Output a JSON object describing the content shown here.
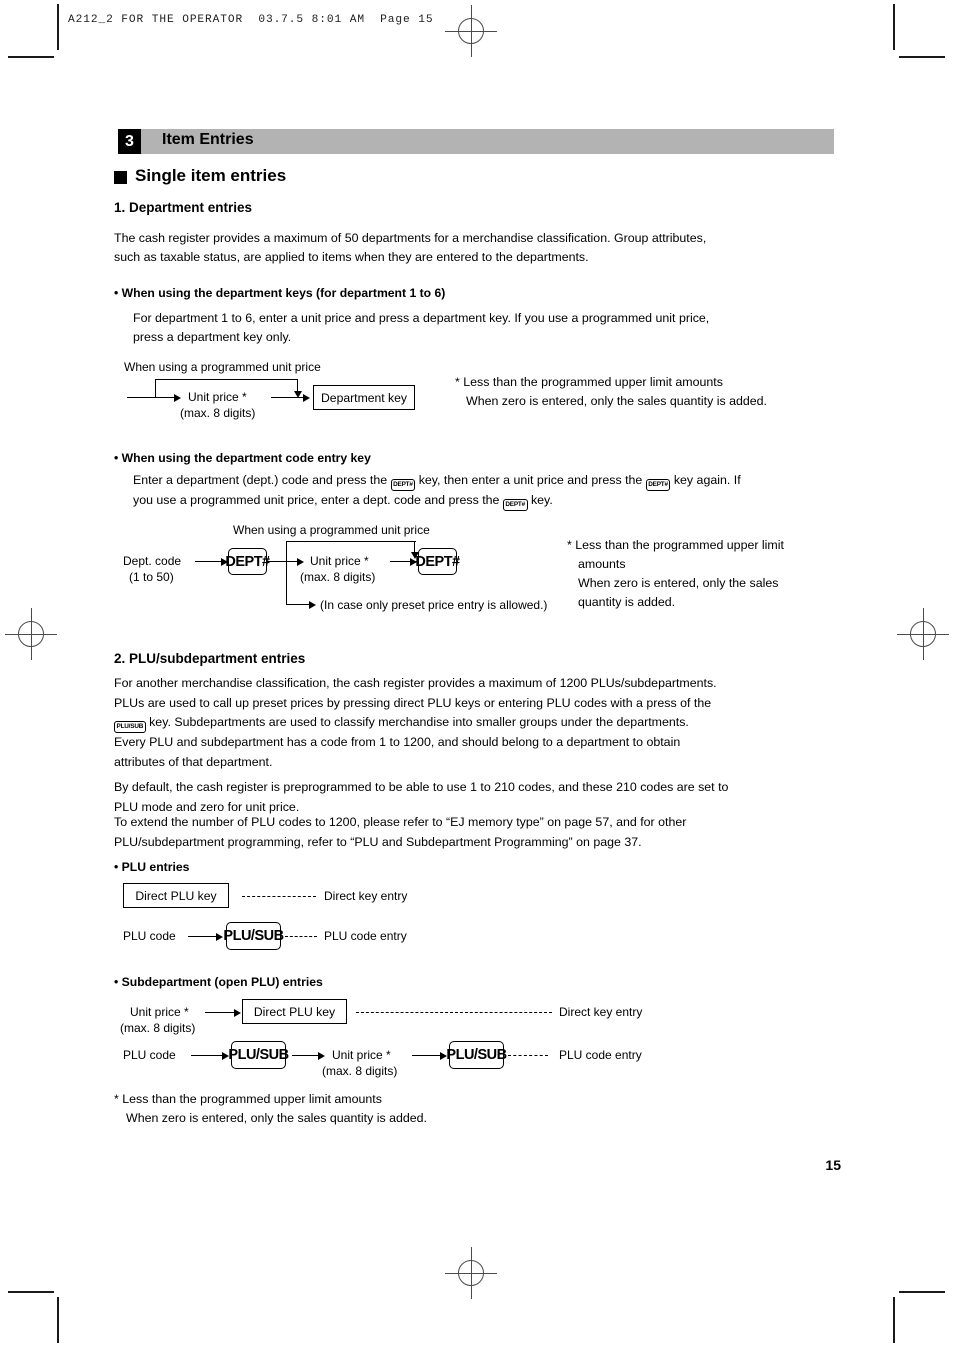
{
  "film_header": "A212_2 FOR THE OPERATOR  03.7.5 8:01 AM  Page 15",
  "chapter": {
    "number": "3",
    "title": "Item Entries"
  },
  "section": {
    "title": "Single item entries"
  },
  "department_entries": {
    "heading": "1. Department entries",
    "intro_line1": "The cash register provides a maximum of 50 departments for a merchandise classification.  Group attributes,",
    "intro_line2": "such as taxable status, are applied to items when they are entered to the departments.",
    "dept_keys": {
      "heading": "• When using the department keys (for department 1 to 6)",
      "body_line1": "For department 1 to 6, enter a unit price and press a department key.  If you use a programmed unit price,",
      "body_line2": "press a department key only."
    },
    "diagram1": {
      "bypass_label": "When using a programmed unit price",
      "unit_price": "Unit price *",
      "unit_price_sub": "(max. 8 digits)",
      "dept_key_box": "Department key"
    },
    "note1": {
      "line1": "* Less than the programmed upper limit amounts",
      "line2": "When zero is entered, only the sales quantity is added."
    },
    "code_entry": {
      "heading": "• When using the department code entry key",
      "body_part1": "Enter a department (dept.) code and press the",
      "key1": "DEPT#",
      "body_part2": "key, then enter a unit price and press the",
      "key2": "DEPT#",
      "body_part3": "key again.  If",
      "body_part4": "you use a programmed unit price, enter a dept. code and press the",
      "key3": "DEPT#",
      "body_part5": "key."
    },
    "diagram2": {
      "bypass_label": "When using a programmed unit price",
      "dept_code": "Dept. code",
      "dept_code_sub": "(1 to 50)",
      "key_left": "DEPT#",
      "unit_price": "Unit price *",
      "unit_price_sub": "(max. 8 digits)",
      "key_right": "DEPT#",
      "preset_note": "(In case only preset price entry is allowed.)"
    },
    "note2": {
      "line1": "* Less than the programmed upper limit",
      "line2": "amounts",
      "line3": "When zero is entered, only the sales",
      "line4": "quantity is added."
    }
  },
  "plu_entries": {
    "heading": "2. PLU/subdepartment entries",
    "para1_line1": "For another merchandise classification, the cash register provides a maximum of 1200 PLUs/subdepartments.",
    "para1_line2": "PLUs are used to call up preset prices by pressing direct PLU keys or entering PLU codes with a press of the",
    "para1_line3_key": "PLU/SUB",
    "para1_line3_rest": "key.  Subdepartments are used to classify merchandise into smaller groups under the departments.",
    "para1_line4": "Every PLU and subdepartment has a code from 1 to 1200, and should belong to a department to obtain",
    "para1_line5": "attributes of that department.",
    "para2_line1": "By default, the cash register is preprogrammed to be able to use 1 to 210 codes, and these 210 codes are set to",
    "para2_line2": "PLU mode and zero for unit price.",
    "para3_line1": "To extend the number of PLU codes to 1200, please refer to “EJ memory type” on page 57, and for other",
    "para3_line2": "PLU/subdepartment programming, refer to “PLU and Subdepartment Programming” on page 37.",
    "plu_section": {
      "heading": "• PLU entries",
      "direct_plu_box": "Direct PLU key",
      "direct_key_entry": "Direct key entry",
      "plu_code": "PLU code",
      "plu_sub_key": "PLU/SUB",
      "plu_code_entry": "PLU code entry"
    },
    "subdept_section": {
      "heading": "• Subdepartment (open PLU) entries",
      "unit_price": "Unit price *",
      "unit_price_sub": "(max. 8 digits)",
      "direct_plu_box": "Direct PLU key",
      "direct_key_entry": "Direct key entry",
      "plu_code": "PLU code",
      "plu_sub_key_1": "PLU/SUB",
      "unit_price_2": "Unit price *",
      "unit_price_2_sub": "(max. 8 digits)",
      "plu_sub_key_2": "PLU/SUB",
      "plu_code_entry": "PLU code entry"
    },
    "note3": {
      "line1": "* Less than the programmed upper limit amounts",
      "line2": "When zero is entered, only the sales quantity is added."
    }
  },
  "page_number": "15",
  "colors": {
    "chapter_bar": "#b3b3b3",
    "chapter_num_bg": "#000000",
    "text": "#000000",
    "reg_mark": "#4a4a4a"
  }
}
